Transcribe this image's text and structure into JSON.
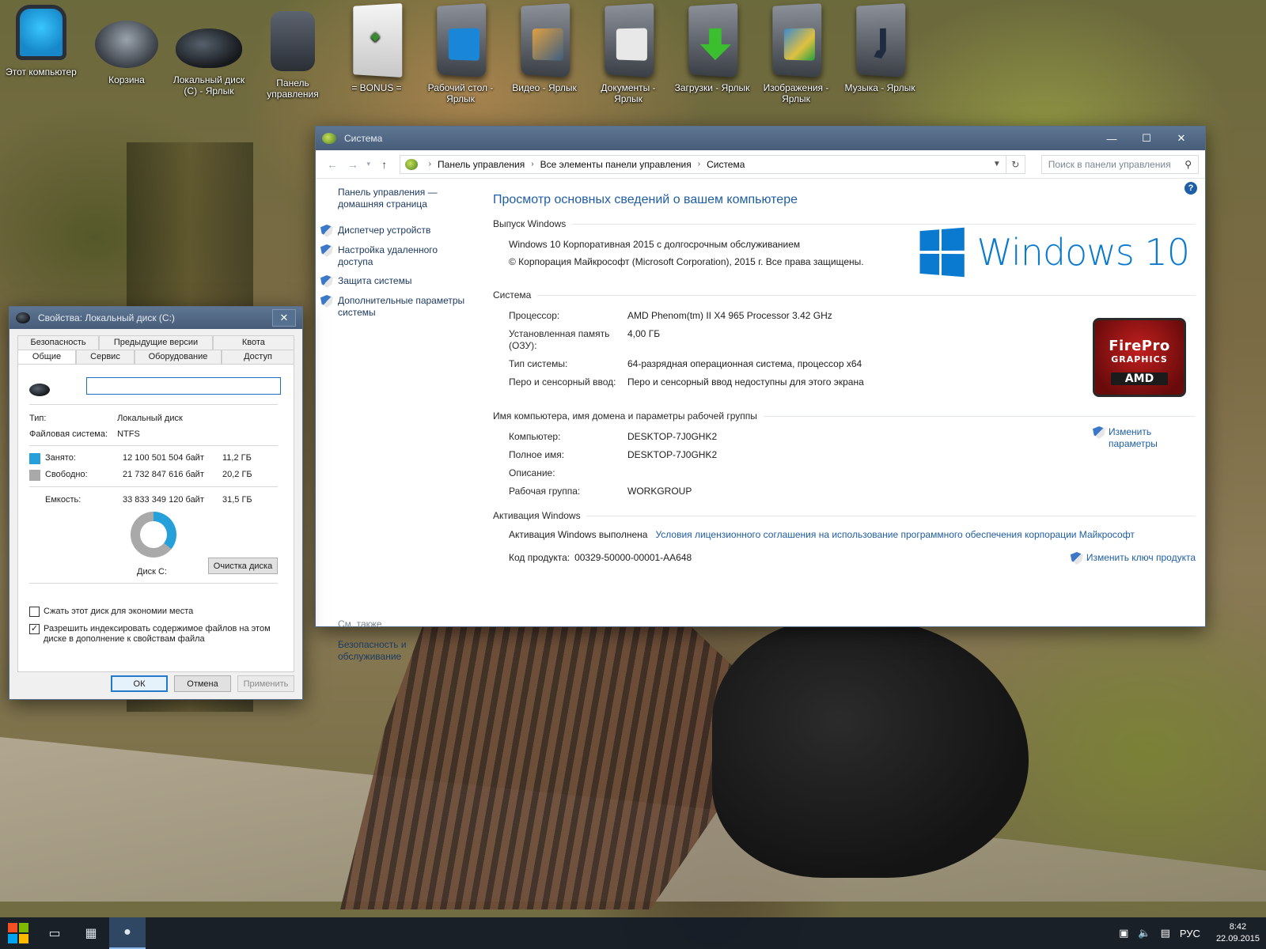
{
  "desktop_icons": [
    {
      "label": "Этот компьютер",
      "icon": "computer-icon"
    },
    {
      "label": "Корзина",
      "icon": "recycle-bin-icon"
    },
    {
      "label": "Локальный диск (C) - Ярлык",
      "icon": "disk-icon"
    },
    {
      "label": "Панель управления",
      "icon": "control-panel-icon"
    },
    {
      "label": "= BONUS =",
      "icon": "bonus-icon"
    },
    {
      "label": "Рабочий стол - Ярлык",
      "icon": "desktop-folder-icon"
    },
    {
      "label": "Видео - Ярлык",
      "icon": "video-folder-icon"
    },
    {
      "label": "Документы - Ярлык",
      "icon": "documents-folder-icon"
    },
    {
      "label": "Загрузки - Ярлык",
      "icon": "downloads-folder-icon"
    },
    {
      "label": "Изображения - Ярлык",
      "icon": "pictures-folder-icon"
    },
    {
      "label": "Музыка - Ярлык",
      "icon": "music-folder-icon"
    }
  ],
  "system_window": {
    "title": "Система",
    "address": {
      "crumbs": [
        "Панель управления",
        "Все элементы панели управления",
        "Система"
      ],
      "search_placeholder": "Поиск в панели управления"
    },
    "left_pane": {
      "home": "Панель управления — домашняя страница",
      "links": [
        "Диспетчер устройств",
        "Настройка удаленного доступа",
        "Защита системы",
        "Дополнительные параметры системы"
      ],
      "see_also": "См. также",
      "see_also_link": "Безопасность и обслуживание"
    },
    "main_title": "Просмотр основных сведений о вашем компьютере",
    "edition": {
      "header": "Выпуск Windows",
      "name": "Windows 10 Корпоративная 2015 с долгосрочным обслуживанием",
      "copyright": "© Корпорация Майкрософт (Microsoft Corporation), 2015 г. Все права защищены.",
      "logo_text": "Windows 10"
    },
    "system": {
      "header": "Система",
      "rows": [
        {
          "k": "Процессор:",
          "v": "AMD Phenom(tm) II X4 965 Processor   3.42 GHz"
        },
        {
          "k": "Установленная память (ОЗУ):",
          "v": "4,00 ГБ"
        },
        {
          "k": "Тип системы:",
          "v": "64-разрядная операционная система, процессор x64"
        },
        {
          "k": "Перо и сенсорный ввод:",
          "v": "Перо и сенсорный ввод недоступны для этого экрана"
        }
      ],
      "badge_line1": "FirePro",
      "badge_line2": "GRAPHICS",
      "badge_line3": "AMD"
    },
    "computer": {
      "header": "Имя компьютера, имя домена и параметры рабочей группы",
      "rows": [
        {
          "k": "Компьютер:",
          "v": "DESKTOP-7J0GHK2"
        },
        {
          "k": "Полное имя:",
          "v": "DESKTOP-7J0GHK2"
        },
        {
          "k": "Описание:",
          "v": ""
        },
        {
          "k": "Рабочая группа:",
          "v": "WORKGROUP"
        }
      ],
      "change_link": "Изменить параметры"
    },
    "activation": {
      "header": "Активация Windows",
      "status": "Активация Windows выполнена",
      "license_link": "Условия лицензионного соглашения на использование программного обеспечения корпорации Майкрософт",
      "product_key_label": "Код продукта:",
      "product_key": "00329-50000-00001-AA648",
      "change_key_link": "Изменить ключ продукта"
    }
  },
  "props_dialog": {
    "title": "Свойства: Локальный диск (C:)",
    "tabs_row1": [
      "Безопасность",
      "Предыдущие версии",
      "Квота"
    ],
    "tabs_row2": [
      "Общие",
      "Сервис",
      "Оборудование",
      "Доступ"
    ],
    "name_value": "",
    "type_label": "Тип:",
    "type_value": "Локальный диск",
    "fs_label": "Файловая система:",
    "fs_value": "NTFS",
    "used_label": "Занято:",
    "used_bytes": "12 100 501 504 байт",
    "used_gb": "11,2 ГБ",
    "free_label": "Свободно:",
    "free_bytes": "21 732 847 616 байт",
    "free_gb": "20,2 ГБ",
    "cap_label": "Емкость:",
    "cap_bytes": "33 833 349 120 байт",
    "cap_gb": "31,5 ГБ",
    "used_fraction": 0.358,
    "disk_label": "Диск C:",
    "cleanup_button": "Очистка диска",
    "compress_label": "Сжать этот диск для экономии места",
    "index_label": "Разрешить индексировать содержимое файлов на этом диске в дополнение к свойствам файла",
    "ok": "ОК",
    "cancel": "Отмена",
    "apply": "Применить",
    "colors": {
      "used": "#26a0da",
      "free": "#a9a9a9"
    }
  },
  "taskbar": {
    "lang": "РУС",
    "time": "8:42",
    "date": "22.09.2015"
  }
}
